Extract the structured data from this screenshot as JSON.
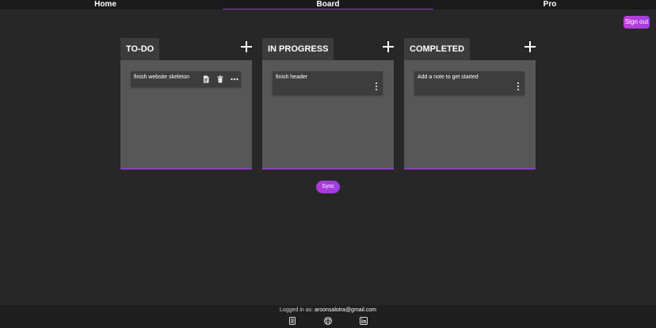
{
  "nav": {
    "home": "Home",
    "board": "Board",
    "pro": "Pro"
  },
  "sign_out": "Sign out",
  "columns": [
    {
      "title": "TO-DO",
      "notes": [
        "finish website skeleton"
      ]
    },
    {
      "title": "IN PROGRESS",
      "notes": [
        "finish header"
      ]
    },
    {
      "title": "COMPLETED",
      "notes": [
        "Add a note to get started"
      ]
    }
  ],
  "sync_label": "Sync",
  "footer": {
    "logged_label": "Logged in as:",
    "email": "aroonsalotra@gmail.com"
  },
  "icons": {
    "column_add": "plus-icon",
    "note_save": "document-icon",
    "note_delete": "trash-icon",
    "note_more": "ellipsis-icon",
    "note_menu": "vertical-dots-icon",
    "footer": [
      "portfolio-icon",
      "github-icon",
      "linkedin-icon"
    ]
  },
  "colors": {
    "accent": "#8a3fbf",
    "button": "#b038d4",
    "background": "#272727",
    "column_body": "#575757",
    "note": "#3d3d3d"
  }
}
